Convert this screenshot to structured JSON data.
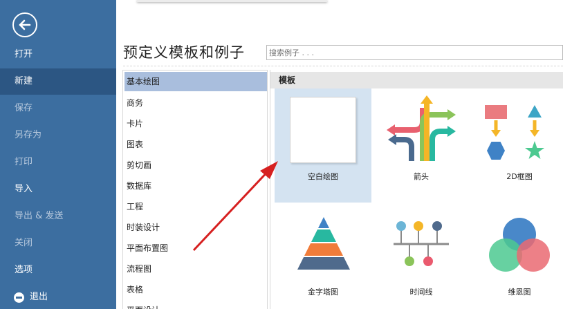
{
  "sidebar": {
    "items": [
      {
        "label": "打开"
      },
      {
        "label": "新建"
      },
      {
        "label": "保存"
      },
      {
        "label": "另存为"
      },
      {
        "label": "打印"
      },
      {
        "label": "导入"
      },
      {
        "label": "导出 & 发送"
      },
      {
        "label": "关闭"
      },
      {
        "label": "选项"
      },
      {
        "label": "退出"
      }
    ],
    "active_item": "新建"
  },
  "header": {
    "title": "预定义模板和例子"
  },
  "search": {
    "placeholder": "搜索例子 . . ."
  },
  "categories": [
    "基本绘图",
    "商务",
    "卡片",
    "图表",
    "剪切画",
    "数据库",
    "工程",
    "时装设计",
    "平面布置图",
    "流程图",
    "表格",
    "平面设计"
  ],
  "selected_category": "基本绘图",
  "templates_panel": {
    "header": "模板",
    "items": [
      {
        "label": "空白绘图",
        "icon": "blank-page-icon"
      },
      {
        "label": "箭头",
        "icon": "arrows-icon"
      },
      {
        "label": "2D框图",
        "icon": "2d-block-icon"
      },
      {
        "label": "金字塔图",
        "icon": "pyramid-icon"
      },
      {
        "label": "时间线",
        "icon": "timeline-icon"
      },
      {
        "label": "维恩图",
        "icon": "venn-icon"
      }
    ],
    "selected": "空白绘图"
  },
  "colors": {
    "sidebar_bg": "#3c6ea0",
    "sidebar_active": "#2c5683",
    "category_selected": "#a9bedd",
    "template_selected": "#d4e3f1",
    "annotation_arrow": "#d62020"
  }
}
